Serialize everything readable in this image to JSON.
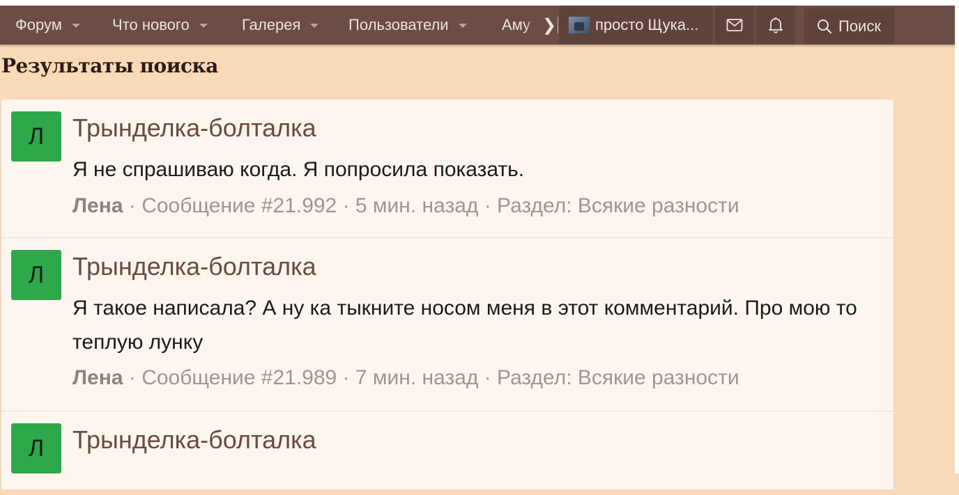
{
  "nav": {
    "items": [
      {
        "label": "Форум"
      },
      {
        "label": "Что нового"
      },
      {
        "label": "Галерея"
      },
      {
        "label": "Пользователи"
      },
      {
        "label": "Аму"
      }
    ],
    "scroll_icon": "chevron-right-icon",
    "user_name": "просто Щука...",
    "icons": [
      "envelope-icon",
      "bell-icon"
    ],
    "search_label": "Поиск",
    "colors": {
      "bar": "#6b4d46",
      "active": "#5e433d",
      "page_bg": "#f9d9b7"
    }
  },
  "page": {
    "title": "Результаты поиска"
  },
  "results": [
    {
      "avatar_letter": "Л",
      "title": "Трынделка-болталка",
      "snippet": "Я не спрашиваю когда. Я попросила показать.",
      "author": "Лена",
      "meta": " · Сообщение #21.992 · 5 мин. назад · Раздел: Всякие разности"
    },
    {
      "avatar_letter": "Л",
      "title": "Трынделка-болталка",
      "snippet": "Я такое написала? А ну ка тыкните носом меня в этот комментарий. Про мою то теплую лунку",
      "author": "Лена",
      "meta": " · Сообщение #21.989 · 7 мин. назад · Раздел: Всякие разности"
    },
    {
      "avatar_letter": "Л",
      "title": "Трынделка-болталка"
    }
  ]
}
